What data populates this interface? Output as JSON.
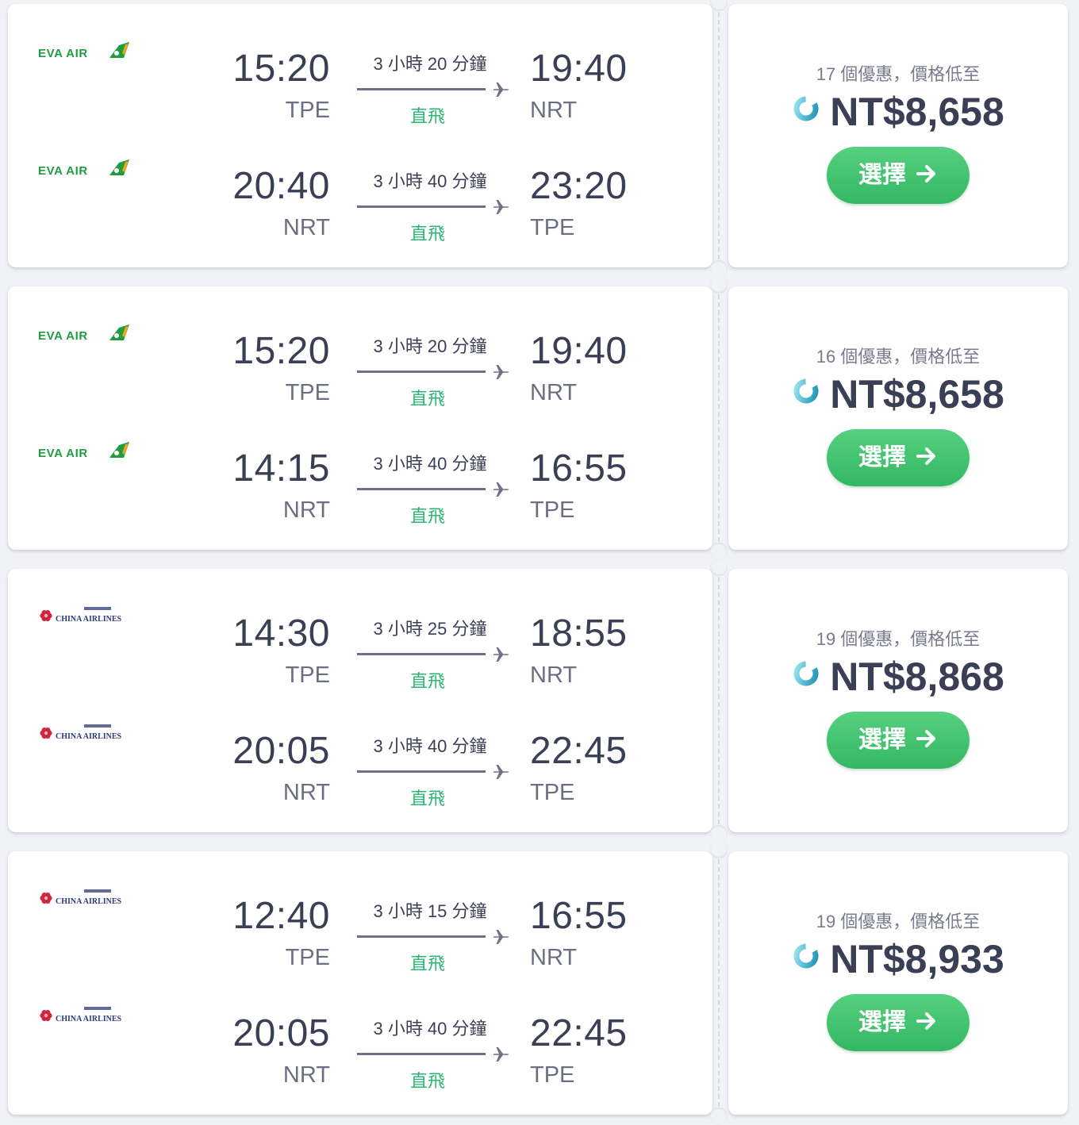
{
  "colors": {
    "page_bg": "#f1f2f8",
    "card_bg": "#ffffff",
    "text_dark": "#3b3f55",
    "text_muted": "#787b8e",
    "nonstop_green": "#2bb673",
    "button_green": "#3cc26c",
    "eva_green": "#1f9d3f",
    "china_red": "#d0263d",
    "china_navy": "#2a3a7a"
  },
  "icons": {
    "plane": "plane-icon",
    "loader": "loader-icon",
    "arrow": "arrow-right-icon"
  },
  "results": [
    {
      "offers_text": "17 個優惠，價格低至",
      "price": "NT$8,658",
      "select_label": "選擇",
      "legs": [
        {
          "airline": "EVA AIR",
          "logo": "eva-air-logo",
          "dep_time": "15:20",
          "dep_code": "TPE",
          "duration": "3 小時 20 分鐘",
          "stops": "直飛",
          "arr_time": "19:40",
          "arr_code": "NRT"
        },
        {
          "airline": "EVA AIR",
          "logo": "eva-air-logo",
          "dep_time": "20:40",
          "dep_code": "NRT",
          "duration": "3 小時 40 分鐘",
          "stops": "直飛",
          "arr_time": "23:20",
          "arr_code": "TPE"
        }
      ]
    },
    {
      "offers_text": "16 個優惠，價格低至",
      "price": "NT$8,658",
      "select_label": "選擇",
      "legs": [
        {
          "airline": "EVA AIR",
          "logo": "eva-air-logo",
          "dep_time": "15:20",
          "dep_code": "TPE",
          "duration": "3 小時 20 分鐘",
          "stops": "直飛",
          "arr_time": "19:40",
          "arr_code": "NRT"
        },
        {
          "airline": "EVA AIR",
          "logo": "eva-air-logo",
          "dep_time": "14:15",
          "dep_code": "NRT",
          "duration": "3 小時 40 分鐘",
          "stops": "直飛",
          "arr_time": "16:55",
          "arr_code": "TPE"
        }
      ]
    },
    {
      "offers_text": "19 個優惠，價格低至",
      "price": "NT$8,868",
      "select_label": "選擇",
      "legs": [
        {
          "airline": "CHINA AIRLINES",
          "logo": "china-airlines-logo",
          "dep_time": "14:30",
          "dep_code": "TPE",
          "duration": "3 小時 25 分鐘",
          "stops": "直飛",
          "arr_time": "18:55",
          "arr_code": "NRT"
        },
        {
          "airline": "CHINA AIRLINES",
          "logo": "china-airlines-logo",
          "dep_time": "20:05",
          "dep_code": "NRT",
          "duration": "3 小時 40 分鐘",
          "stops": "直飛",
          "arr_time": "22:45",
          "arr_code": "TPE"
        }
      ]
    },
    {
      "offers_text": "19 個優惠，價格低至",
      "price": "NT$8,933",
      "select_label": "選擇",
      "legs": [
        {
          "airline": "CHINA AIRLINES",
          "logo": "china-airlines-logo",
          "dep_time": "12:40",
          "dep_code": "TPE",
          "duration": "3 小時 15 分鐘",
          "stops": "直飛",
          "arr_time": "16:55",
          "arr_code": "NRT"
        },
        {
          "airline": "CHINA AIRLINES",
          "logo": "china-airlines-logo",
          "dep_time": "20:05",
          "dep_code": "NRT",
          "duration": "3 小時 40 分鐘",
          "stops": "直飛",
          "arr_time": "22:45",
          "arr_code": "TPE"
        }
      ]
    }
  ]
}
